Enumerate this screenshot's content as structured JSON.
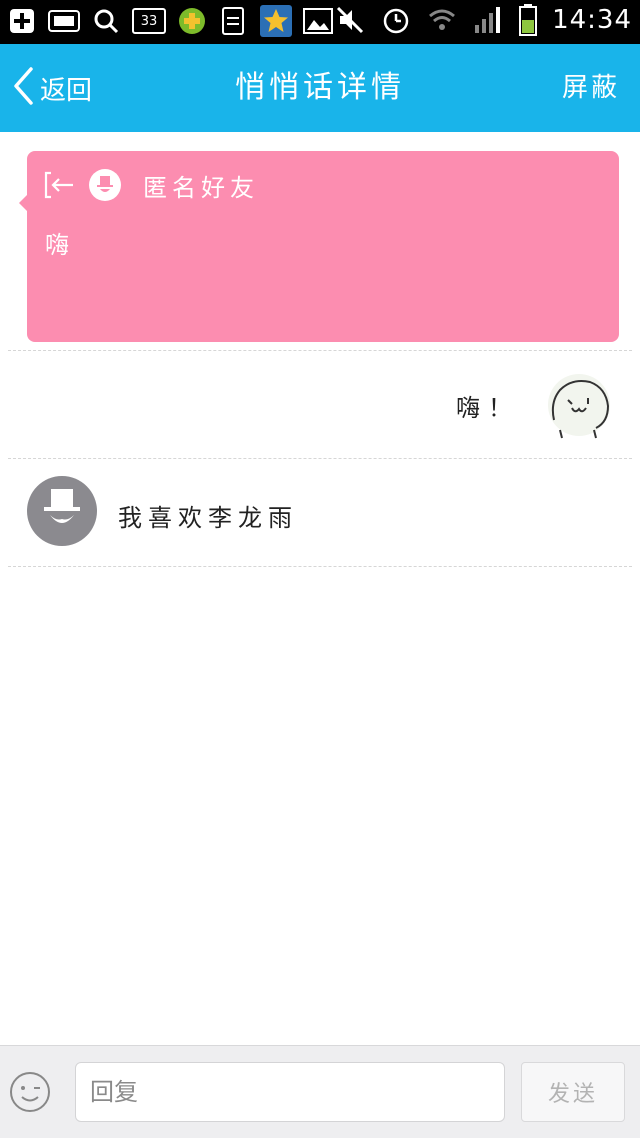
{
  "status_bar": {
    "time": "14:34",
    "notification_badge": "33",
    "icons": [
      "add-icon",
      "sim-card-icon",
      "search-icon",
      "badge-33-icon",
      "plus-circle-icon",
      "document-icon",
      "star-app-icon",
      "image-icon",
      "mute-icon",
      "alarm-icon",
      "wifi-icon",
      "signal-icon",
      "battery-icon"
    ]
  },
  "header": {
    "back_label": "返回",
    "title": "悄悄话详情",
    "block_label": "屏蔽"
  },
  "card": {
    "sender": "匿名好友",
    "message": "嗨",
    "color": "#fc8db0"
  },
  "reply": {
    "text": "嗨！"
  },
  "message": {
    "text": "我喜欢李龙雨"
  },
  "composer": {
    "placeholder": "回复",
    "send_label": "发送"
  },
  "colors": {
    "accent": "#19b4ea",
    "card": "#fc8db0",
    "avatar": "#8b8a8f"
  }
}
